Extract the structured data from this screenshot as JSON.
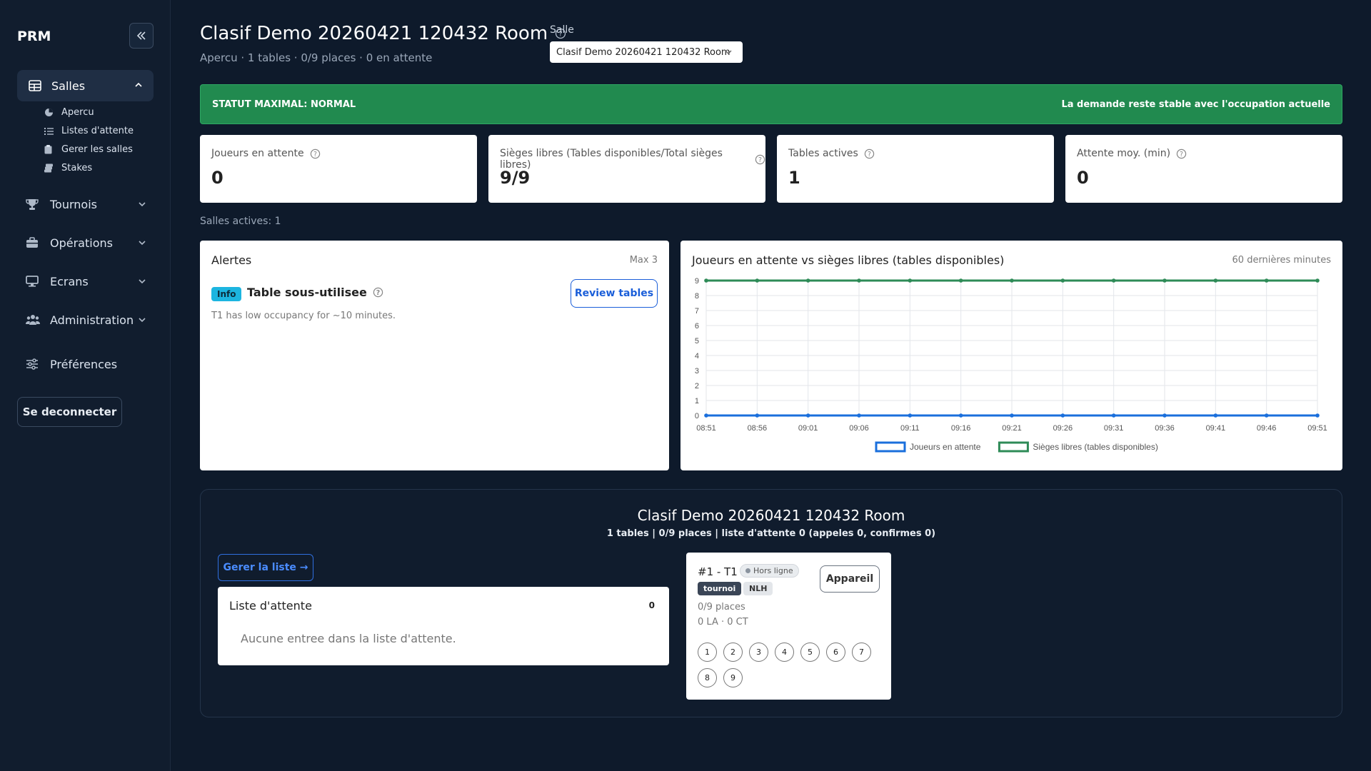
{
  "sidebar": {
    "brand": "PRM",
    "active_section": "Salles",
    "sub_items": [
      "Apercu",
      "Listes d'attente",
      "Gerer les salles",
      "Stakes"
    ],
    "sections": [
      "Tournois",
      "Opérations",
      "Ecrans",
      "Administration"
    ],
    "preferences": "Préférences",
    "logout": "Se deconnecter"
  },
  "header": {
    "title": "Clasif Demo 20260421 120432 Room",
    "subtitle": "Apercu · 1 tables · 0/9 places · 0 en attente",
    "salle_label": "Salle",
    "salle_value": "Clasif Demo 20260421 120432 Room"
  },
  "status": {
    "left": "STATUT MAXIMAL: NORMAL",
    "right": "La demande reste stable avec l'occupation actuelle",
    "color": "#218a4f"
  },
  "metrics": [
    {
      "label": "Joueurs en attente",
      "value": "0"
    },
    {
      "label": "Sièges libres (Tables disponibles/Total sièges libres)",
      "value": "9/9"
    },
    {
      "label": "Tables actives",
      "value": "1"
    },
    {
      "label": "Attente moy. (min)",
      "value": "0"
    }
  ],
  "salles_actives": "Salles actives: 1",
  "alerts": {
    "title": "Alertes",
    "max": "Max 3",
    "badge": "Info",
    "alert_title": "Table sous-utilisee",
    "button": "Review tables",
    "description": "T1 has low occupancy for ~10 minutes."
  },
  "chart": {
    "title": "Joueurs en attente vs sièges libres (tables disponibles)",
    "range_label": "60 dernières minutes"
  },
  "chart_data": {
    "type": "line",
    "title": "Joueurs en attente vs sièges libres (tables disponibles)",
    "x": [
      "08:51",
      "08:56",
      "09:01",
      "09:06",
      "09:11",
      "09:16",
      "09:21",
      "09:26",
      "09:31",
      "09:36",
      "09:41",
      "09:46",
      "09:51"
    ],
    "series": [
      {
        "name": "Joueurs en attente",
        "color": "#1a6fdc",
        "values": [
          0,
          0,
          0,
          0,
          0,
          0,
          0,
          0,
          0,
          0,
          0,
          0,
          0
        ]
      },
      {
        "name": "Sièges libres (tables disponibles)",
        "color": "#2e8b57",
        "values": [
          9,
          9,
          9,
          9,
          9,
          9,
          9,
          9,
          9,
          9,
          9,
          9,
          9
        ]
      }
    ],
    "ylim": [
      0,
      9
    ],
    "yticks": [
      "0",
      "1",
      "2",
      "3",
      "4",
      "5",
      "6",
      "7",
      "8",
      "9"
    ],
    "grid": true,
    "legend": "bottom"
  },
  "room": {
    "title": "Clasif Demo 20260421 120432 Room",
    "summary": "1 tables | 0/9 places | liste d'attente 0 (appeles 0, confirmes 0)",
    "manage_button": "Gerer la liste →",
    "waitlist_title": "Liste d'attente",
    "waitlist_count": "0",
    "waitlist_empty": "Aucune entree dans la liste d'attente.",
    "table": {
      "name": "#1 - T1",
      "status": "Hors ligne",
      "tag1": "tournoi",
      "tag2": "NLH",
      "call_button": "Appareil",
      "places": "0/9 places",
      "la_ct": "0 LA · 0 CT",
      "seats": [
        "1",
        "2",
        "3",
        "4",
        "5",
        "6",
        "7",
        "8",
        "9"
      ]
    }
  }
}
